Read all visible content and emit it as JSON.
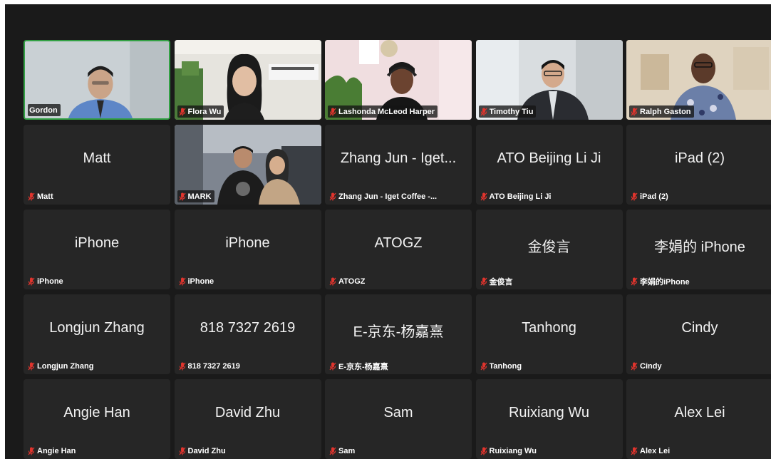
{
  "colors": {
    "background": "#1a1a1a",
    "tile": "#262626",
    "active_speaker_border": "#33a145",
    "muted_mic": "#e0342d"
  },
  "participants": [
    {
      "label": "Gordon",
      "video": true,
      "muted": false,
      "active": true
    },
    {
      "label": "Flora Wu",
      "video": true,
      "muted": true
    },
    {
      "label": "Lashonda McLeod Harper",
      "video": true,
      "muted": true
    },
    {
      "label": "Timothy Tiu",
      "video": true,
      "muted": true
    },
    {
      "label": "Ralph Gaston",
      "video": true,
      "muted": true
    },
    {
      "display": "Matt",
      "label": "Matt",
      "video": false,
      "muted": true
    },
    {
      "label": "MARK",
      "video": true,
      "muted": true
    },
    {
      "display": "Zhang Jun - Iget...",
      "label": "Zhang Jun - Iget Coffee -...",
      "video": false,
      "muted": true
    },
    {
      "display": "ATO Beijing Li Ji",
      "label": "ATO Beijing Li Ji",
      "video": false,
      "muted": true
    },
    {
      "display": "iPad (2)",
      "label": "iPad (2)",
      "video": false,
      "muted": true
    },
    {
      "display": "iPhone",
      "label": "iPhone",
      "video": false,
      "muted": true
    },
    {
      "display": "iPhone",
      "label": "iPhone",
      "video": false,
      "muted": true
    },
    {
      "display": "ATOGZ",
      "label": "ATOGZ",
      "video": false,
      "muted": true
    },
    {
      "display": "金俊言",
      "label": "金俊言",
      "video": false,
      "muted": true
    },
    {
      "display": "李娟的 iPhone",
      "label": "李娟的iPhone",
      "video": false,
      "muted": true
    },
    {
      "display": "Longjun Zhang",
      "label": "Longjun Zhang",
      "video": false,
      "muted": true
    },
    {
      "display": "818 7327 2619",
      "label": "818 7327 2619",
      "video": false,
      "muted": true
    },
    {
      "display": "E-京东-杨嘉熹",
      "label": "E-京东-杨嘉熹",
      "video": false,
      "muted": true
    },
    {
      "display": "Tanhong",
      "label": "Tanhong",
      "video": false,
      "muted": true
    },
    {
      "display": "Cindy",
      "label": "Cindy",
      "video": false,
      "muted": true
    },
    {
      "display": "Angie Han",
      "label": "Angie Han",
      "video": false,
      "muted": true
    },
    {
      "display": "David Zhu",
      "label": "David Zhu",
      "video": false,
      "muted": true
    },
    {
      "display": "Sam",
      "label": "Sam",
      "video": false,
      "muted": true
    },
    {
      "display": "Ruixiang Wu",
      "label": "Ruixiang Wu",
      "video": false,
      "muted": true
    },
    {
      "display": "Alex Lei",
      "label": "Alex Lei",
      "video": false,
      "muted": true
    }
  ]
}
